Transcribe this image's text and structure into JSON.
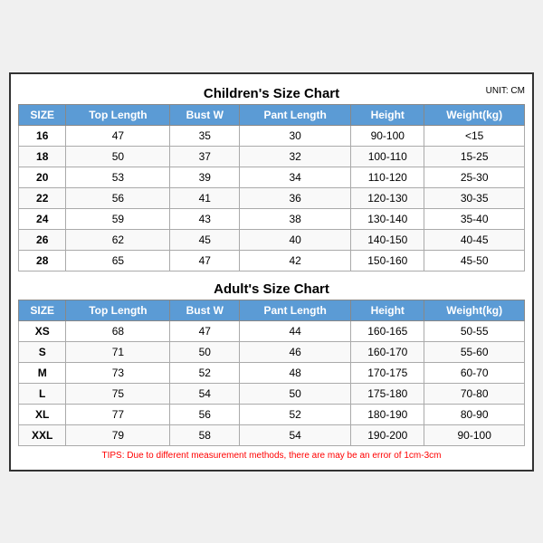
{
  "children": {
    "title": "Children's Size Chart",
    "unit": "UNIT: CM",
    "headers": [
      "SIZE",
      "Top Length",
      "Bust W",
      "Pant Length",
      "Height",
      "Weight(kg)"
    ],
    "rows": [
      [
        "16",
        "47",
        "35",
        "30",
        "90-100",
        "<15"
      ],
      [
        "18",
        "50",
        "37",
        "32",
        "100-110",
        "15-25"
      ],
      [
        "20",
        "53",
        "39",
        "34",
        "110-120",
        "25-30"
      ],
      [
        "22",
        "56",
        "41",
        "36",
        "120-130",
        "30-35"
      ],
      [
        "24",
        "59",
        "43",
        "38",
        "130-140",
        "35-40"
      ],
      [
        "26",
        "62",
        "45",
        "40",
        "140-150",
        "40-45"
      ],
      [
        "28",
        "65",
        "47",
        "42",
        "150-160",
        "45-50"
      ]
    ]
  },
  "adults": {
    "title": "Adult's Size Chart",
    "headers": [
      "SIZE",
      "Top Length",
      "Bust W",
      "Pant Length",
      "Height",
      "Weight(kg)"
    ],
    "rows": [
      [
        "XS",
        "68",
        "47",
        "44",
        "160-165",
        "50-55"
      ],
      [
        "S",
        "71",
        "50",
        "46",
        "160-170",
        "55-60"
      ],
      [
        "M",
        "73",
        "52",
        "48",
        "170-175",
        "60-70"
      ],
      [
        "L",
        "75",
        "54",
        "50",
        "175-180",
        "70-80"
      ],
      [
        "XL",
        "77",
        "56",
        "52",
        "180-190",
        "80-90"
      ],
      [
        "XXL",
        "79",
        "58",
        "54",
        "190-200",
        "90-100"
      ]
    ]
  },
  "tips": "TIPS: Due to different measurement methods, there are may be an error of 1cm-3cm"
}
